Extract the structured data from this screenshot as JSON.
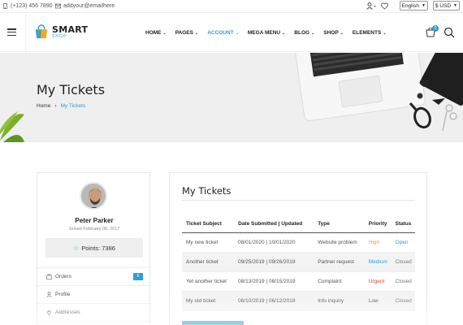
{
  "topbar": {
    "phone": "(+123) 456 7890",
    "email": "addyour@emailhere",
    "language": "English",
    "currency": "$ USD"
  },
  "brand": {
    "name": "SMART",
    "tagline": "SHOP"
  },
  "nav": [
    {
      "label": "HOME",
      "active": false
    },
    {
      "label": "PAGES",
      "active": false
    },
    {
      "label": "ACCOUNT",
      "active": true
    },
    {
      "label": "MEGA MENU",
      "active": false
    },
    {
      "label": "BLOG",
      "active": false
    },
    {
      "label": "SHOP",
      "active": false
    },
    {
      "label": "ELEMENTS",
      "active": false
    }
  ],
  "cart": {
    "count": "0"
  },
  "hero": {
    "title": "My Tickets",
    "breadcrumb_home": "Home",
    "breadcrumb_current": "My Tickets"
  },
  "profile": {
    "name": "Peter Parker",
    "joined": "Joined February 06, 2017",
    "points": "Points: 7386",
    "menu": [
      {
        "label": "Orders",
        "badge": "6"
      },
      {
        "label": "Profile",
        "badge": ""
      },
      {
        "label": "Addresses",
        "badge": ""
      }
    ]
  },
  "tickets": {
    "title": "My Tickets",
    "columns": [
      "Ticket Subject",
      "Date Submitted | Updated",
      "Type",
      "Priority",
      "Status"
    ],
    "rows": [
      {
        "subject": "My new ticket",
        "dates": "08/01/2020 | 10/01/2020",
        "type": "Website problem",
        "priority": "High",
        "status": "Open"
      },
      {
        "subject": "Another ticket",
        "dates": "09/25/2019 | 09/26/2019",
        "type": "Partner request",
        "priority": "Medium",
        "status": "Closed"
      },
      {
        "subject": "Yet another ticket",
        "dates": "08/13/2019 | 08/15/2019",
        "type": "Complaint",
        "priority": "Urgent",
        "status": "Closed"
      },
      {
        "subject": "My old ticket",
        "dates": "06/10/2019 | 06/12/2019",
        "type": "Info inquiry",
        "priority": "Low",
        "status": "Closed"
      }
    ]
  },
  "colors": {
    "accent": "#2a9fd6",
    "high": "#f5a623",
    "urgent": "#e53935",
    "hero_bg": "#efefef"
  },
  "icons": [
    "phone-icon",
    "mail-icon",
    "user-icon",
    "heart-icon",
    "menu-icon",
    "cart-icon",
    "search-icon",
    "star-icon",
    "bag-icon",
    "pin-icon"
  ]
}
